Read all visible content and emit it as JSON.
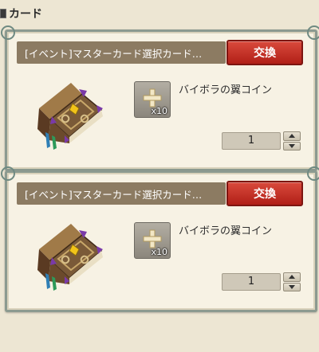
{
  "section": {
    "title": "カード",
    "icon": "card-category-icon"
  },
  "items": [
    {
      "title": "[イベント]マスターカード選択カード…",
      "exchange_label": "交換",
      "item_icon": "spellbook-icon",
      "cost": {
        "icon": "plus-icon",
        "quantity": "x10",
        "name": "バイボラの翼コイン"
      },
      "quantity_value": "1"
    },
    {
      "title": "[イベント]マスターカード選択カード…",
      "exchange_label": "交換",
      "item_icon": "spellbook-icon",
      "cost": {
        "icon": "plus-icon",
        "quantity": "x10",
        "name": "バイボラの翼コイン"
      },
      "quantity_value": "1"
    }
  ]
}
